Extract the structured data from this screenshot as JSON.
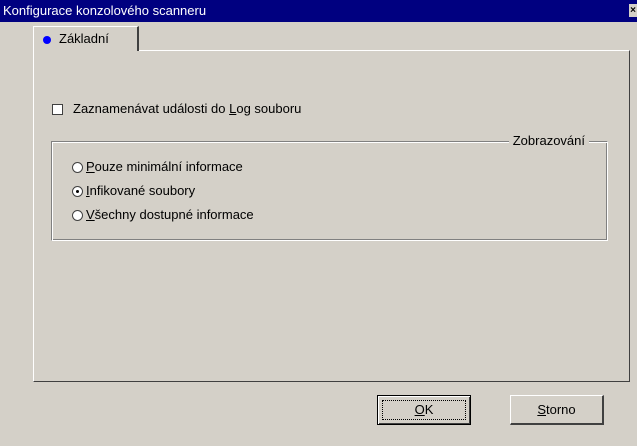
{
  "window": {
    "title": "Konfigurace konzolového scanneru",
    "close_glyph": "×"
  },
  "tabs": [
    {
      "label": "Základní",
      "icon": "blue-bullet-icon"
    }
  ],
  "log_checkbox": {
    "prefix": "Zaznamenávat události do ",
    "access": "L",
    "suffix": "og souboru",
    "checked": false
  },
  "display_group": {
    "title": "Zobrazování",
    "options": [
      {
        "access": "P",
        "rest": "ouze minimální informace",
        "selected": false
      },
      {
        "access": "I",
        "rest": "nfikované soubory",
        "selected": true
      },
      {
        "access": "V",
        "rest": "šechny dostupné informace",
        "selected": false
      }
    ]
  },
  "buttons": {
    "ok": {
      "access": "O",
      "rest": "K"
    },
    "storno": {
      "access": "S",
      "rest": "torno"
    }
  }
}
